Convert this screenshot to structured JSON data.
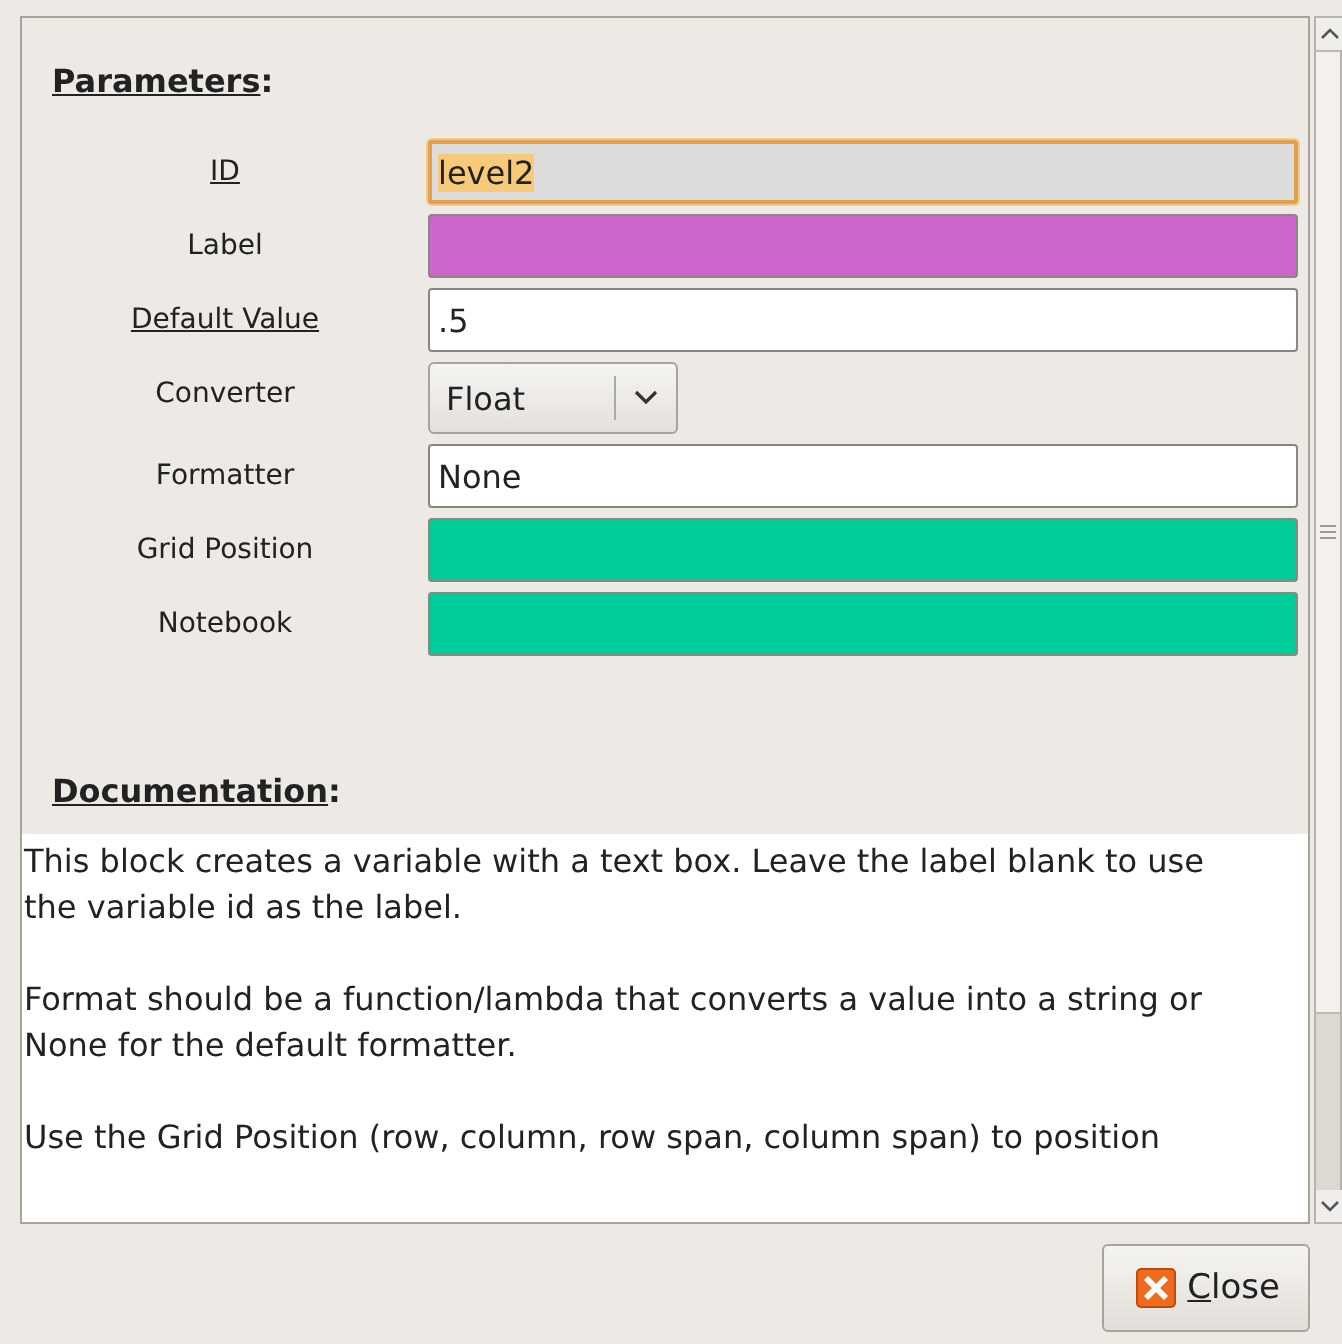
{
  "parameters": {
    "heading": "Parameters",
    "colon": ":",
    "fields": [
      {
        "label": "ID",
        "underlined": true,
        "kind": "entry",
        "value": "level2",
        "focused": true,
        "color": "#dcdcdc"
      },
      {
        "label": "Label",
        "underlined": false,
        "kind": "entry",
        "focused": false,
        "color": "#cc66cc"
      },
      {
        "label": "Default Value",
        "underlined": true,
        "kind": "entry",
        "value": ".5",
        "focused": false,
        "color": "#ffffff"
      },
      {
        "label": "Converter",
        "underlined": false,
        "kind": "combo",
        "value": "Float"
      },
      {
        "label": "Formatter",
        "underlined": false,
        "kind": "entry",
        "value": "None",
        "focused": false,
        "color": "#ffffff"
      },
      {
        "label": "Grid Position",
        "underlined": false,
        "kind": "entry",
        "focused": false,
        "color": "#00cc99"
      },
      {
        "label": "Notebook",
        "underlined": false,
        "kind": "entry",
        "focused": false,
        "color": "#00cc99"
      }
    ]
  },
  "documentation": {
    "heading": "Documentation",
    "colon": ":",
    "paragraphs": [
      "This block creates a variable with a text box. Leave the label blank to use the variable id as the label.",
      "Format should be a function/lambda that converts a value into a string or None for the default formatter.",
      "Use the Grid Position (row, column, row span, column span) to position"
    ]
  },
  "buttons": [
    {
      "label": "Close"
    }
  ]
}
